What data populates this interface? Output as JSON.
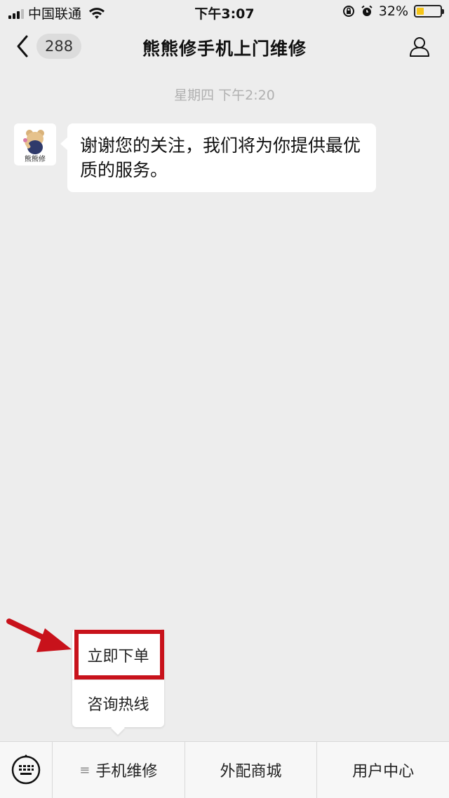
{
  "status_bar": {
    "carrier": "中国联通",
    "time": "下午3:07",
    "battery_percent": "32%",
    "battery_level": 0.32,
    "icons": [
      "signal-icon",
      "wifi-icon",
      "lock-rotation-icon",
      "alarm-icon",
      "battery-icon"
    ]
  },
  "nav": {
    "unread_count": "288",
    "title": "熊熊修手机上门维修",
    "icons": [
      "back-chevron-icon",
      "profile-icon"
    ]
  },
  "chat": {
    "timestamp": "星期四 下午2:20",
    "messages": [
      {
        "sender_avatar_text": "熊熊修",
        "text": "谢谢您的关注，我们将为你提供最优质的服务。"
      }
    ]
  },
  "popup_menu": {
    "items": [
      {
        "label": "立即下单",
        "highlighted": true
      },
      {
        "label": "咨询热线"
      }
    ],
    "highlight_color": "#c8121b"
  },
  "bottom_bar": {
    "keyboard_icon": "keyboard-icon",
    "tabs": [
      {
        "label": "手机维修",
        "has_submenu_icon": true
      },
      {
        "label": "外配商城"
      },
      {
        "label": "用户中心"
      }
    ]
  }
}
